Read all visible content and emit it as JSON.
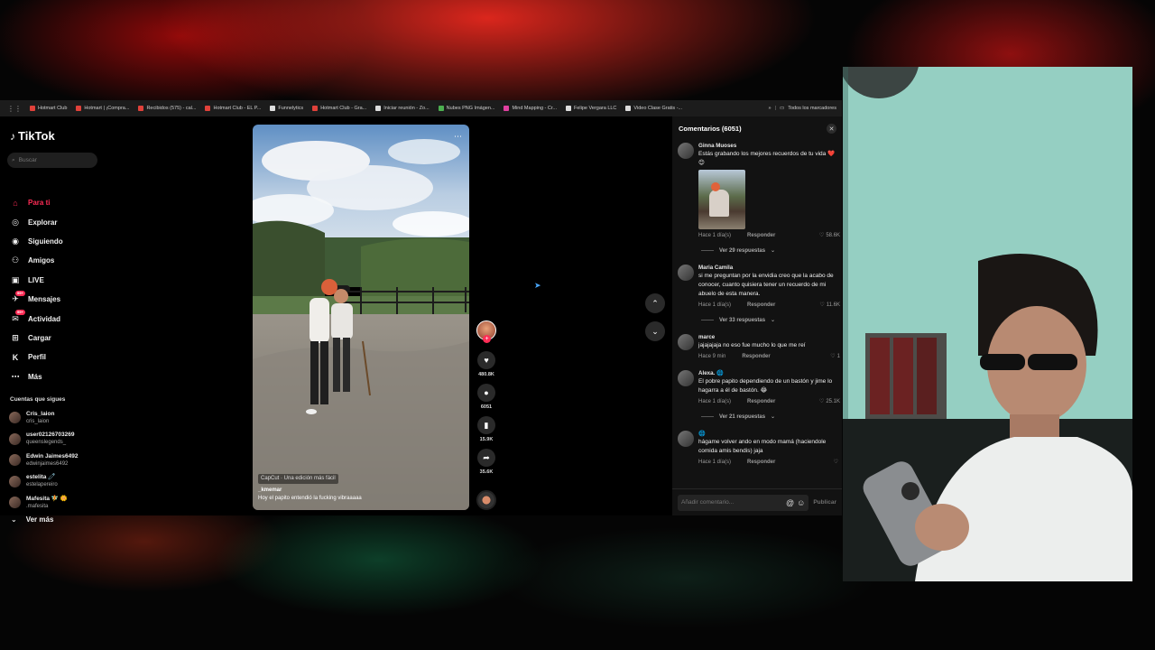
{
  "bookmarks": {
    "items": [
      {
        "label": "Hotmart Club",
        "color": "#e0413a"
      },
      {
        "label": "Hotmart | ¡Compra...",
        "color": "#e0413a"
      },
      {
        "label": "Recibidos (575) - cal...",
        "color": "#e0413a"
      },
      {
        "label": "Hotmart Club - EL P...",
        "color": "#e0413a"
      },
      {
        "label": "Funnelytics",
        "color": "#dddddd"
      },
      {
        "label": "Hotmart Club - Gra...",
        "color": "#e0413a"
      },
      {
        "label": "Iniciar reunión - Zo...",
        "color": "#dddddd"
      },
      {
        "label": "Nubes PNG Imágen...",
        "color": "#4caf50"
      },
      {
        "label": "Mind Mapping - Cr...",
        "color": "#e040a0"
      },
      {
        "label": "Felipe Vergara LLC",
        "color": "#dddddd"
      },
      {
        "label": "Video Clase Gratis -...",
        "color": "#dddddd"
      }
    ],
    "all_bookmarks": "Todos los marcadores"
  },
  "sidebar": {
    "logo": "TikTok",
    "search_placeholder": "Buscar",
    "nav": [
      {
        "label": "Para ti",
        "icon": "home-icon",
        "glyph": "⌂",
        "active": true
      },
      {
        "label": "Explorar",
        "icon": "compass-icon",
        "glyph": "◎",
        "active": false
      },
      {
        "label": "Siguiendo",
        "icon": "following-icon",
        "glyph": "◉",
        "active": false
      },
      {
        "label": "Amigos",
        "icon": "friends-icon",
        "glyph": "⚇",
        "active": false
      },
      {
        "label": "LIVE",
        "icon": "live-icon",
        "glyph": "▣",
        "active": false
      },
      {
        "label": "Mensajes",
        "icon": "messages-icon",
        "glyph": "✈",
        "active": false,
        "badge": "99+"
      },
      {
        "label": "Actividad",
        "icon": "activity-icon",
        "glyph": "✉",
        "active": false,
        "badge": "99+"
      },
      {
        "label": "Cargar",
        "icon": "upload-icon",
        "glyph": "⊞",
        "active": false
      },
      {
        "label": "Perfil",
        "icon": "profile-icon",
        "glyph": "K",
        "active": false
      },
      {
        "label": "Más",
        "icon": "more-icon",
        "glyph": "⋯",
        "active": false
      }
    ],
    "follows_title": "Cuentas que sigues",
    "follows": [
      {
        "name": "Cris_laion",
        "handle": "cris_laion"
      },
      {
        "name": "user02126703269",
        "handle": "queenslegends_"
      },
      {
        "name": "Edwin Jaimes6492",
        "handle": "edwinjaimes6492"
      },
      {
        "name": "estelita 🧷",
        "handle": "estelapereiro"
      },
      {
        "name": "Mafesita 🧚 🌼",
        "handle": ".mafesita"
      }
    ],
    "see_more": "Ver más"
  },
  "video": {
    "capcut": "CapCut · Una edición más fácil",
    "author": "_kmemar",
    "caption": "Hoy el papito entendió la fucking vibraaaaa"
  },
  "actions": {
    "likes": "480.8K",
    "comments": "6051",
    "saves": "15.9K",
    "shares": "35.6K"
  },
  "comments": {
    "title": "Comentarios (6051)",
    "placeholder": "Añadir comentario...",
    "publish": "Publicar",
    "reply_label": "Responder",
    "items": [
      {
        "user": "Ginna Muoses",
        "text": "Estás grabando los mejores recuerdos de tu vida ❤️😊",
        "time": "Hace 1 día(s)",
        "likes": "58.6K",
        "replies": "Ver 29 respuestas",
        "image": true
      },
      {
        "user": "Maria Camila",
        "text": "si me preguntan por la envidia creo que la acabo de conocer, cuanto quisiera tener un recuerdo de mi abuelo de esta manera.",
        "time": "Hace 1 día(s)",
        "likes": "11.6K",
        "replies": "Ver 33 respuestas"
      },
      {
        "user": "marce",
        "text": "jajajajaja no eso fue mucho lo que me reí",
        "time": "Hace 9 min",
        "likes": "1",
        "replies": ""
      },
      {
        "user": "Alexa. 🌐",
        "text": "El pobre papito dependiendo de un bastón y jime lo hagarra a él de bastón. 😂",
        "time": "Hace 1 día(s)",
        "likes": "25.1K",
        "replies": "Ver 21 respuestas"
      },
      {
        "user": "🌐",
        "text": "hágame volver ando en modo mamá (haciendole comida amis bendis) jaja",
        "time": "Hace 1 día(s)",
        "likes": "",
        "replies": ""
      }
    ]
  }
}
